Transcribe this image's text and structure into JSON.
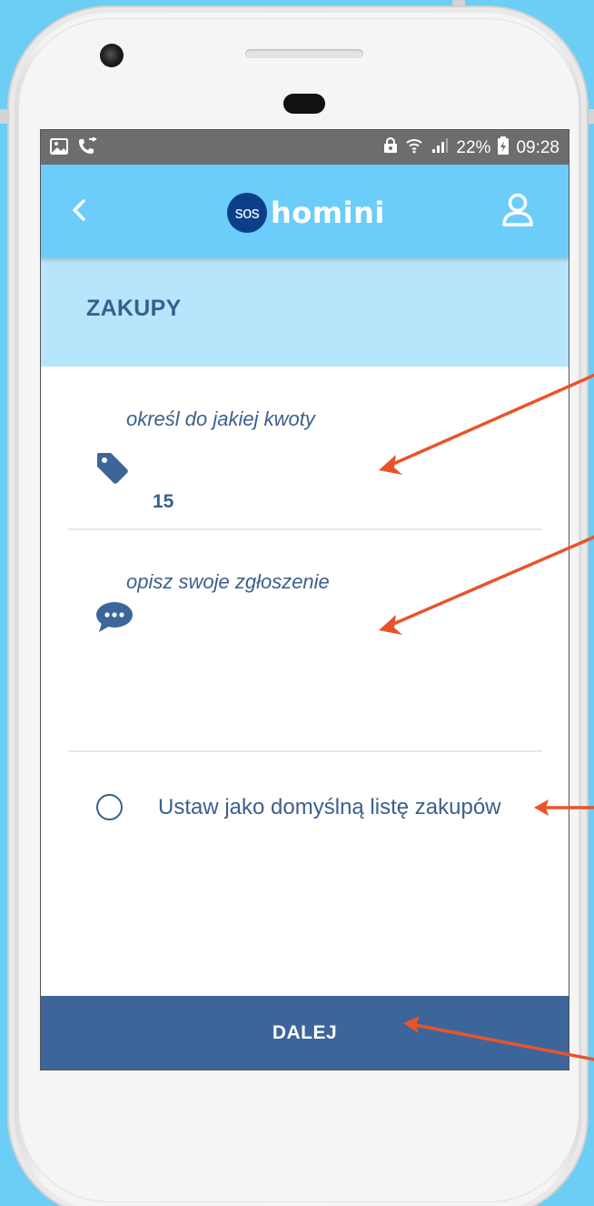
{
  "status_bar": {
    "battery_percent": "22%",
    "time": "09:28"
  },
  "app_bar": {
    "logo_badge": "sos",
    "logo_text": "homini"
  },
  "section": {
    "title": "ZAKUPY"
  },
  "amount_field": {
    "label": "określ do jakiej kwoty",
    "value": "15",
    "icon": "price-tag-icon"
  },
  "description_field": {
    "label": "opisz swoje zgłoszenie",
    "value": "",
    "icon": "chat-bubble-icon"
  },
  "default_option": {
    "label": "Ustaw jako domyślną listę zakupów",
    "checked": false
  },
  "next_button": {
    "label": "DALEJ"
  },
  "colors": {
    "accent": "#6ccdfa",
    "primary": "#3c669a",
    "text": "#3b5f8c",
    "annotation_arrow": "#e8542a"
  }
}
